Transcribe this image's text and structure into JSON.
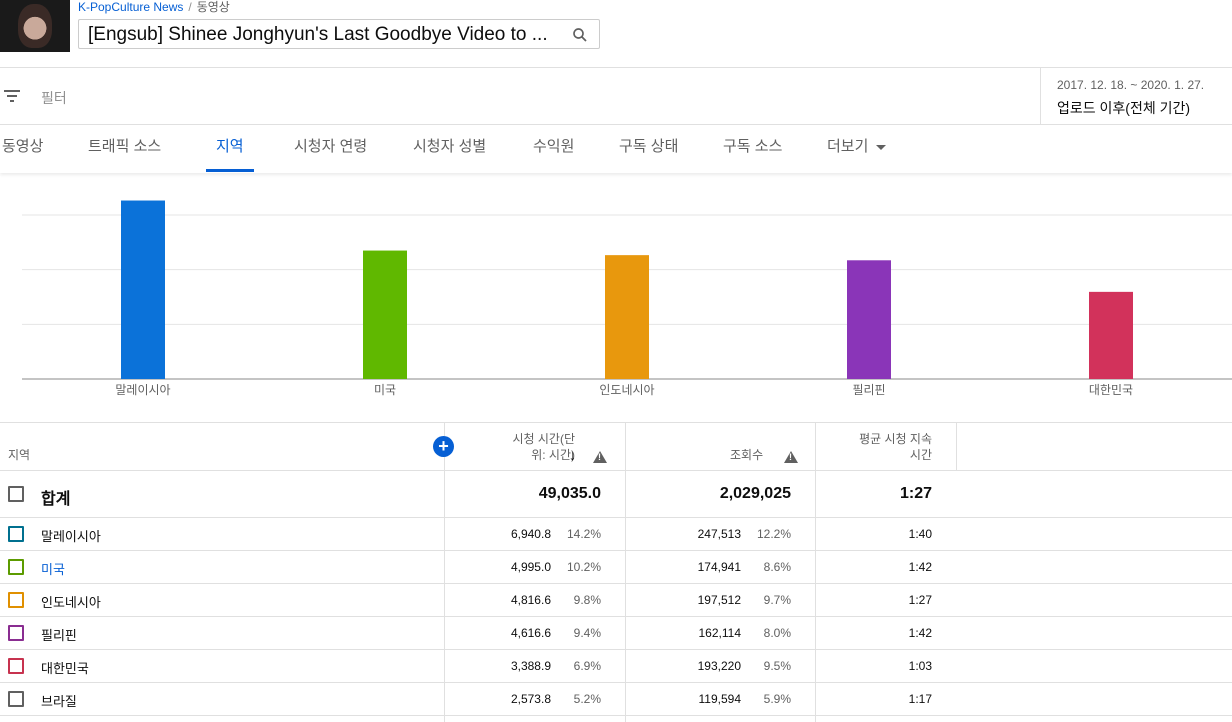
{
  "header": {
    "channel": "K-PopCulture News",
    "breadcrumb_sep": "/",
    "section": "동영상",
    "video_title": "[Engsub] Shinee Jonghyun's Last Goodbye Video to ..."
  },
  "filter": {
    "label": "필터",
    "date_range": "2017. 12. 18. ~ 2020. 1. 27.",
    "period": "업로드 이후(전체 기간)"
  },
  "tabs": [
    {
      "label": "동영상"
    },
    {
      "label": "트래픽 소스"
    },
    {
      "label": "지역"
    },
    {
      "label": "시청자 연령"
    },
    {
      "label": "시청자 성별"
    },
    {
      "label": "수익원"
    },
    {
      "label": "구독 상태"
    },
    {
      "label": "구독 소스"
    },
    {
      "label": "더보기"
    }
  ],
  "active_tab": "지역",
  "chart_data": {
    "type": "bar",
    "categories": [
      "말레이시아",
      "미국",
      "인도네시아",
      "필리핀",
      "대한민국"
    ],
    "values": [
      6940.8,
      4995.0,
      4816.6,
      4616.6,
      3388.9
    ],
    "colors": [
      "#0b72d9",
      "#60b800",
      "#e8980d",
      "#8a35b8",
      "#d2325b"
    ],
    "ylim": [
      0,
      7000
    ],
    "grid": true
  },
  "table": {
    "headers": {
      "region": "지역",
      "watch_time_line1": "시청 시간(단",
      "watch_time_line2": "위: 시간)",
      "views": "조회수",
      "avg_duration_line1": "평균 시청 지속",
      "avg_duration_line2": "시간"
    },
    "total": {
      "label": "합계",
      "watch_time": "49,035.0",
      "views": "2,029,025",
      "avg_duration": "1:27"
    },
    "rows": [
      {
        "region": "말레이시아",
        "watch_time": "6,940.8",
        "watch_pct": "14.2%",
        "views": "247,513",
        "views_pct": "12.2%",
        "avg_duration": "1:40",
        "color": "#00708f"
      },
      {
        "region": "미국",
        "watch_time": "4,995.0",
        "watch_pct": "10.2%",
        "views": "174,941",
        "views_pct": "8.6%",
        "avg_duration": "1:42",
        "color": "#5c9b00"
      },
      {
        "region": "인도네시아",
        "watch_time": "4,816.6",
        "watch_pct": "9.8%",
        "views": "197,512",
        "views_pct": "9.7%",
        "avg_duration": "1:27",
        "color": "#e09000"
      },
      {
        "region": "필리핀",
        "watch_time": "4,616.6",
        "watch_pct": "9.4%",
        "views": "162,114",
        "views_pct": "8.0%",
        "avg_duration": "1:42",
        "color": "#8a2d91"
      },
      {
        "region": "대한민국",
        "watch_time": "3,388.9",
        "watch_pct": "6.9%",
        "views": "193,220",
        "views_pct": "9.5%",
        "avg_duration": "1:03",
        "color": "#c7334f"
      },
      {
        "region": "브라질",
        "watch_time": "2,573.8",
        "watch_pct": "5.2%",
        "views": "119,594",
        "views_pct": "5.9%",
        "avg_duration": "1:17",
        "color": "#606060"
      }
    ]
  }
}
